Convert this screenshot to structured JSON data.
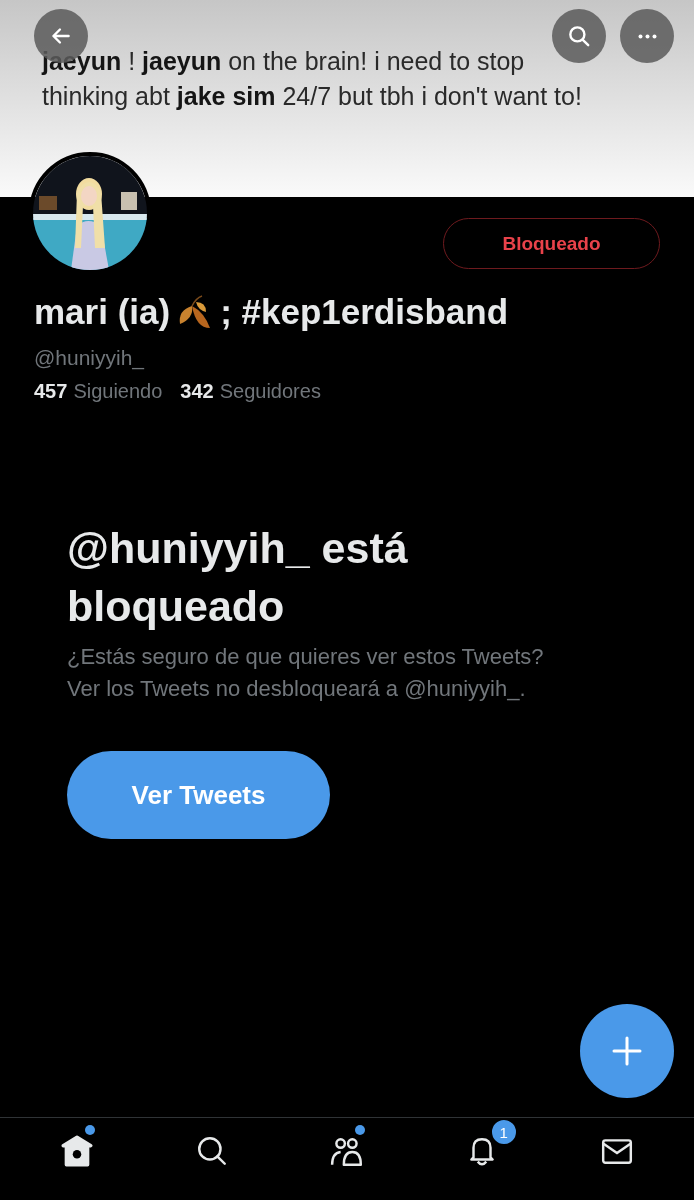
{
  "banner": {
    "lines": [
      "**jaeyun** !  **jaeyun** on the brain! i need to stop",
      "thinking abt **jake sim** 24/7 but tbh i don't want to!"
    ]
  },
  "header_buttons": [
    {
      "kind": "back"
    },
    {
      "kind": "search"
    },
    {
      "kind": "more"
    }
  ],
  "profile": {
    "block_button": "Bloqueado",
    "name_start": "mari (ia)",
    "name_end": "; #kep1erdisband",
    "handle": "@huniyyih_",
    "stats": [
      {
        "count": "457",
        "label": "Siguiendo"
      },
      {
        "count": "342",
        "label": "Seguidores"
      }
    ]
  },
  "blocked_notice": {
    "title": "@huniyyih_ está bloqueado",
    "text": "¿Estás seguro de que quieres ver estos Tweets? Ver los Tweets no desbloqueará a @huniyyih_.",
    "button": "Ver Tweets"
  },
  "compose_button": {
    "kind": "plus"
  },
  "bottom_nav": [
    {
      "kind": "home",
      "selected": true,
      "new_dot": true
    },
    {
      "kind": "search",
      "selected": false,
      "new_dot": false
    },
    {
      "kind": "people",
      "selected": false,
      "new_dot": true
    },
    {
      "kind": "bell",
      "selected": false,
      "new_dot": false,
      "badge": "1"
    },
    {
      "kind": "mail",
      "selected": false,
      "new_dot": false
    }
  ]
}
